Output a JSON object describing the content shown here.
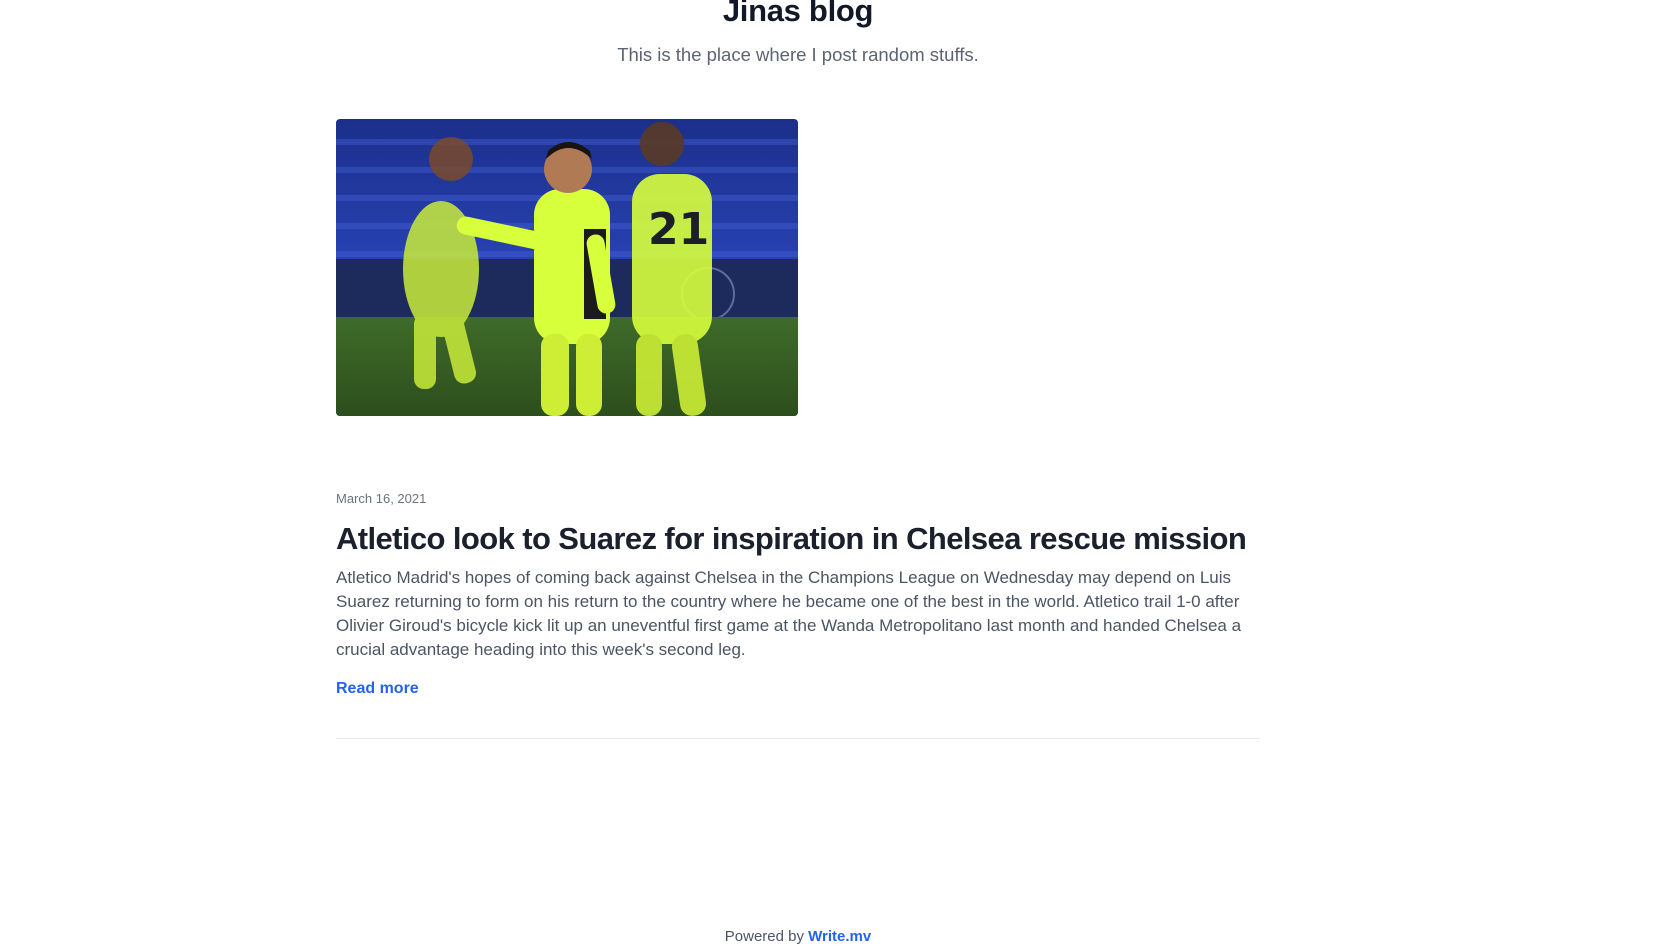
{
  "header": {
    "title": "Jinas blog",
    "subtitle": "This is the place where I post random stuffs."
  },
  "post": {
    "image_alt": "Atletico players in neon kits on the pitch",
    "date": "March 16, 2021",
    "title": "Atletico look to Suarez for inspiration in Chelsea rescue mission",
    "excerpt": "Atletico Madrid's hopes of coming back against Chelsea in the Champions League on Wednesday may depend on Luis Suarez returning to form on his return to the country where he became one of the best in the world. Atletico trail 1-0 after Olivier Giroud's bicycle kick lit up an uneventful first game at the Wanda Metropolitano last month and handed Chelsea a crucial advantage heading into this week's second leg.",
    "read_more": "Read more"
  },
  "footer": {
    "powered_by": "Powered by",
    "link": "Write.mv"
  },
  "colors": {
    "accent": "#2563eb",
    "title": "#1a202c",
    "kit": "#d8ff3c"
  }
}
